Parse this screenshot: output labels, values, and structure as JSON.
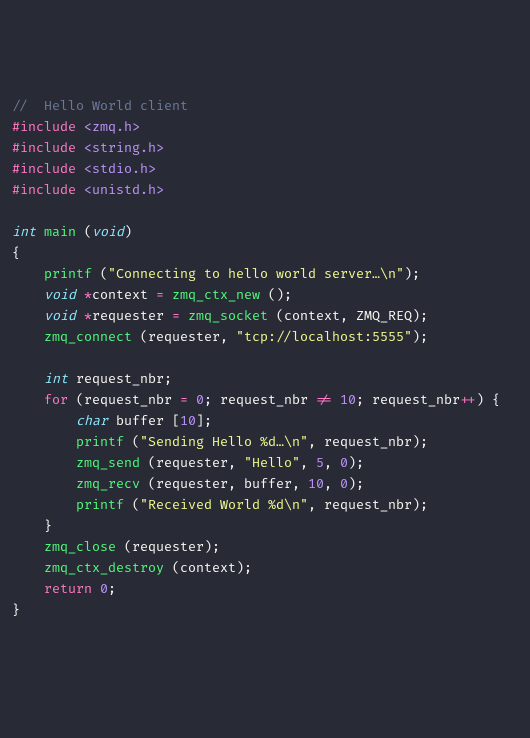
{
  "code": {
    "comment": "//  Hello World client",
    "inc1_kw": "#include",
    "inc1_h": "<zmq.h>",
    "inc2_kw": "#include",
    "inc2_h": "<string.h>",
    "inc3_kw": "#include",
    "inc3_h": "<stdio.h>",
    "inc4_kw": "#include",
    "inc4_h": "<unistd.h>",
    "ret_t": "int",
    "main": "main",
    "void_p": "void",
    "obrace": "{",
    "cbrace": "}",
    "printf": "printf",
    "str_connect": "\"Connecting to hello world server…\\n\"",
    "void_kw": "void",
    "ctx": "context",
    "eq": "=",
    "zmq_ctx_new": "zmq_ctx_new",
    "req": "requester",
    "zmq_socket": "zmq_socket",
    "zmq_req": "ZMQ_REQ",
    "zmq_connect": "zmq_connect",
    "str_tcp": "\"tcp://localhost:5555\"",
    "int_kw": "int",
    "rnbr": "request_nbr",
    "for": "for",
    "zero": "0",
    "ne": "!=",
    "ten": "10",
    "pp": "++",
    "char_kw": "char",
    "buf": "buffer",
    "bsz": "10",
    "str_send": "\"Sending Hello %d…\\n\"",
    "zmq_send": "zmq_send",
    "str_hello": "\"Hello\"",
    "five": "5",
    "zmq_recv": "zmq_recv",
    "str_recv": "\"Received World %d\\n\"",
    "zmq_close": "zmq_close",
    "zmq_ctx_destroy": "zmq_ctx_destroy",
    "return": "return"
  }
}
